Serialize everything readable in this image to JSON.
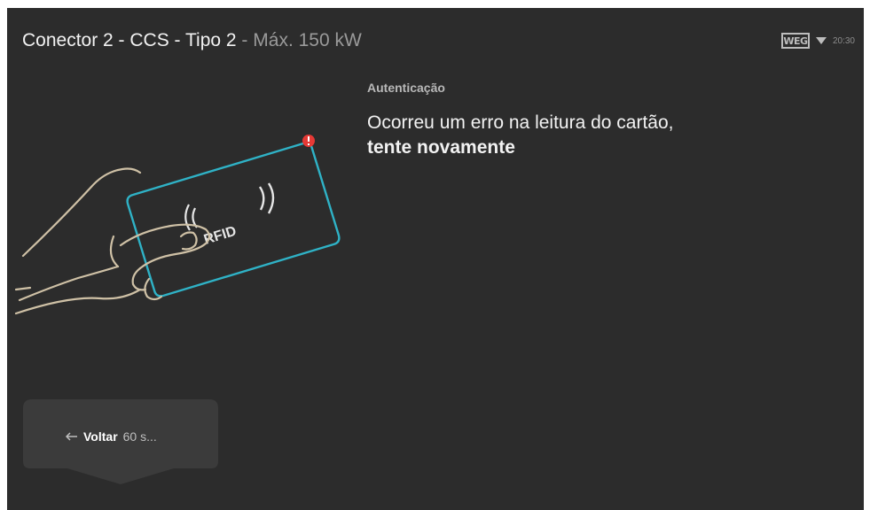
{
  "header": {
    "connector": "Conector 2 - CCS - Tipo 2",
    "separator": " - ",
    "max_power": "Máx. 150 kW"
  },
  "status_bar": {
    "logo_text": "WEG",
    "logo_icon": "weg-logo",
    "wifi_icon": "wifi-icon",
    "time": "20:30"
  },
  "auth": {
    "section_label": "Autenticação",
    "message_part1": "Ocorreu um erro na leitura do cartão, ",
    "message_bold": "tente novamente"
  },
  "illustration": {
    "card_text": "RFID",
    "icon": "hand-holding-rfid-card",
    "error_badge_icon": "error-icon",
    "colors": {
      "card_outline": "#2fb2c6",
      "hand_outline": "#cfc1a6",
      "error_badge": "#e53935"
    }
  },
  "back_button": {
    "icon": "arrow-left-icon",
    "label": "Voltar",
    "countdown": "60 s..."
  },
  "colors": {
    "background": "#2c2c2c",
    "button_background": "#3b3b3b",
    "primary_text": "#f2f2f2",
    "secondary_text": "#9a9a9a"
  }
}
